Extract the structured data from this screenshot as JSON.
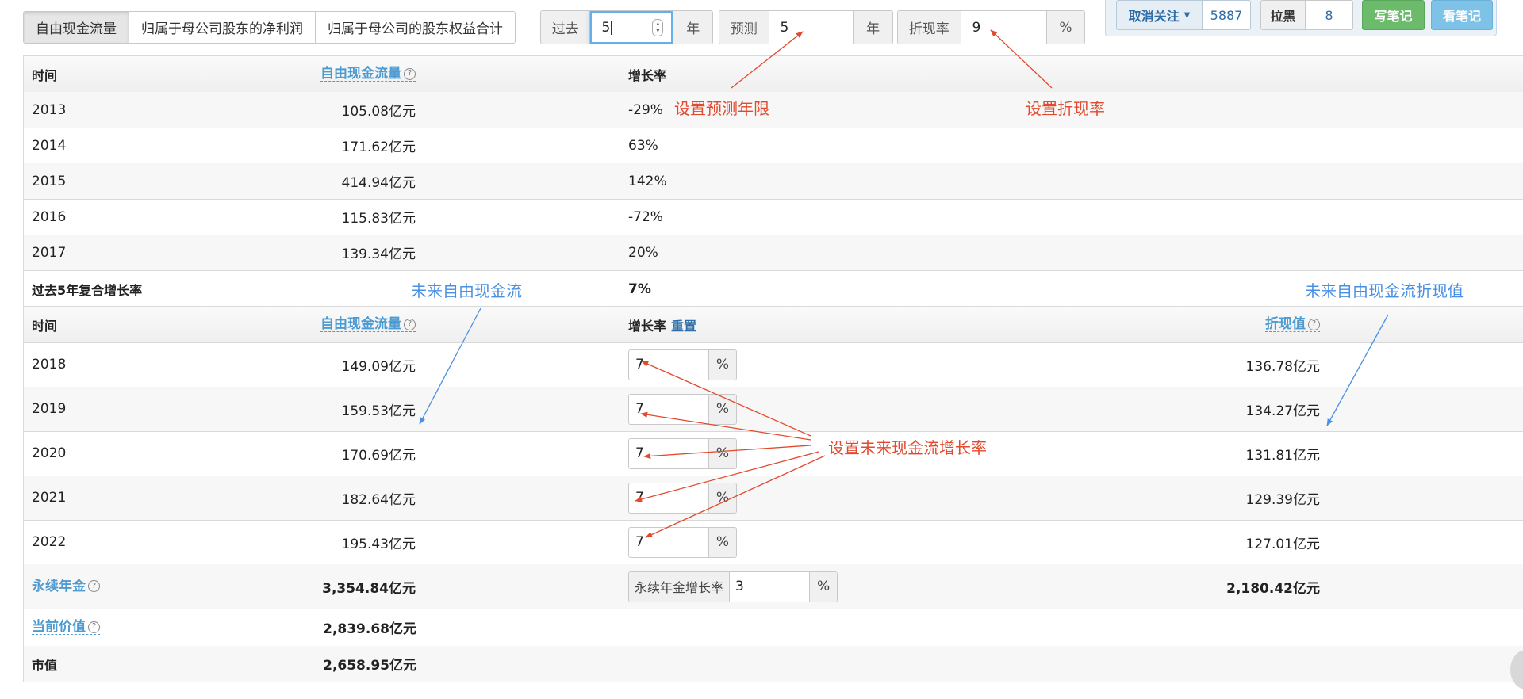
{
  "toolbar": {
    "tabs": [
      {
        "label": "自由现金流量",
        "active": true
      },
      {
        "label": "归属于母公司股东的净利润",
        "active": false
      },
      {
        "label": "归属于母公司的股东权益合计",
        "active": false
      }
    ],
    "past": {
      "label": "过去",
      "value": "5",
      "unit": "年"
    },
    "forecast": {
      "label": "预测",
      "value": "5",
      "unit": "年"
    },
    "discount": {
      "label": "折现率",
      "value": "9",
      "unit": "%"
    },
    "follow_label": "取消关注",
    "follow_count": "5887",
    "block_label": "拉黑",
    "block_count": "8",
    "write_note": "写笔记",
    "view_note": "看笔记"
  },
  "history": {
    "headers": {
      "time": "时间",
      "fcf": "自由现金流量",
      "growth": "增长率"
    },
    "rows": [
      {
        "year": "2013",
        "fcf": "105.08亿元",
        "growth": "-29%"
      },
      {
        "year": "2014",
        "fcf": "171.62亿元",
        "growth": "63%"
      },
      {
        "year": "2015",
        "fcf": "414.94亿元",
        "growth": "142%"
      },
      {
        "year": "2016",
        "fcf": "115.83亿元",
        "growth": "-72%"
      },
      {
        "year": "2017",
        "fcf": "139.34亿元",
        "growth": "20%"
      }
    ],
    "cagr_label": "过去5年复合增长率",
    "cagr_value": "7%"
  },
  "forecast_table": {
    "headers": {
      "time": "时间",
      "fcf": "自由现金流量",
      "growth": "增长率",
      "reset": "重置",
      "pv": "折现值"
    },
    "rows": [
      {
        "year": "2018",
        "fcf": "149.09亿元",
        "growth": "7",
        "pv": "136.78亿元"
      },
      {
        "year": "2019",
        "fcf": "159.53亿元",
        "growth": "7",
        "pv": "134.27亿元"
      },
      {
        "year": "2020",
        "fcf": "170.69亿元",
        "growth": "7",
        "pv": "131.81亿元"
      },
      {
        "year": "2021",
        "fcf": "182.64亿元",
        "growth": "7",
        "pv": "129.39亿元"
      },
      {
        "year": "2022",
        "fcf": "195.43亿元",
        "growth": "7",
        "pv": "127.01亿元"
      }
    ],
    "pct": "%",
    "perpetuity": {
      "label": "永续年金",
      "value": "3,354.84亿元",
      "rate_label": "永续年金增长率",
      "rate": "3",
      "pv": "2,180.42亿元"
    },
    "current": {
      "label": "当前价值",
      "value": "2,839.68亿元"
    },
    "market": {
      "label": "市值",
      "value": "2,658.95亿元"
    }
  },
  "annotations": {
    "forecast_years": "设置预测年限",
    "discount_rate": "设置折现率",
    "future_fcf": "未来自由现金流",
    "future_fcf_pv": "未来自由现金流折现值",
    "growth_rate": "设置未来现金流增长率"
  },
  "colors": {
    "accent": "#4d9bd1",
    "annotation_red": "#e2492d",
    "annotation_blue": "#4a90e2",
    "write_btn": "#6cba6c",
    "view_btn": "#7fc2e8"
  }
}
